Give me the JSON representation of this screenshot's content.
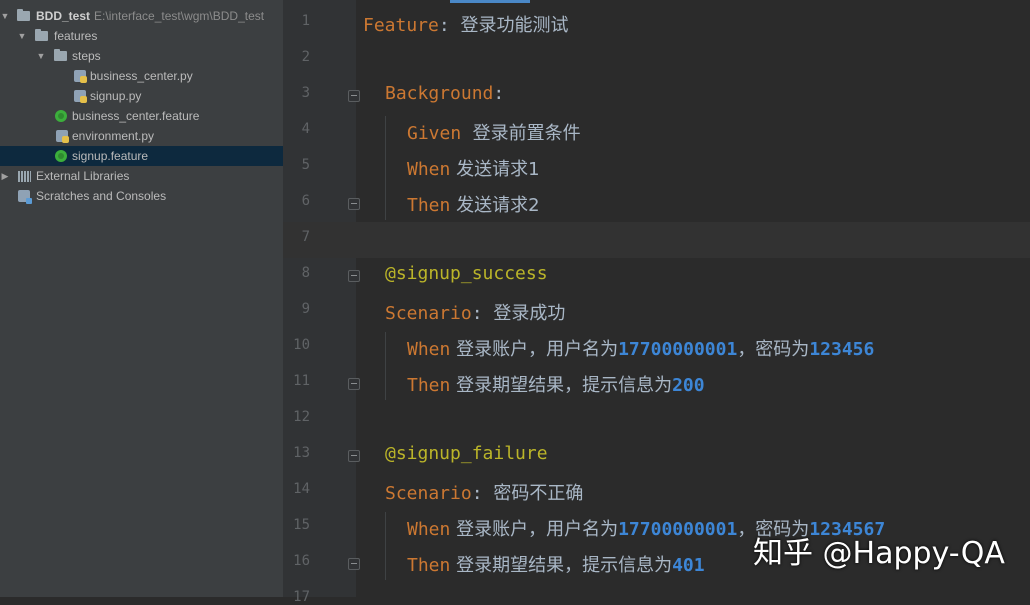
{
  "project_tree": {
    "root": {
      "name": "BDD_test",
      "path": "E:\\interface_test\\wgm\\BDD_test"
    },
    "features": "features",
    "steps": "steps",
    "business_center_py": "business_center.py",
    "signup_py": "signup.py",
    "business_center_feature": "business_center.feature",
    "environment_py": "environment.py",
    "signup_feature": "signup.feature",
    "external_libraries": "External Libraries",
    "scratches": "Scratches and Consoles",
    "selected_item": "signup.feature"
  },
  "editor": {
    "current_line": 7,
    "line_numbers": [
      "1",
      "2",
      "3",
      "4",
      "5",
      "6",
      "7",
      "8",
      "9",
      "10",
      "11",
      "12",
      "13",
      "14",
      "15",
      "16",
      "17"
    ],
    "lines": {
      "l1": {
        "kw": "Feature",
        "sep": ": ",
        "text": "登录功能测试"
      },
      "l3": {
        "kw": "Background",
        "sep": ":"
      },
      "l4": {
        "kw": "Given",
        "text": "  登录前置条件"
      },
      "l5": {
        "kw": "When",
        "text": " 发送请求1"
      },
      "l6": {
        "kw": "Then",
        "text": " 发送请求2"
      },
      "l8": {
        "tag": "@signup_success"
      },
      "l9": {
        "kw": "Scenario",
        "sep": ": ",
        "text": "登录成功"
      },
      "l10": {
        "kw": "When",
        "text1": " 登录账户，用户名为",
        "num1": "17700000001",
        "text2": "，密码为",
        "num2": "123456"
      },
      "l11": {
        "kw": "Then",
        "text1": " 登录期望结果，提示信息为",
        "num1": "200"
      },
      "l13": {
        "tag": "@signup_failure"
      },
      "l14": {
        "kw": "Scenario",
        "sep": ": ",
        "text": "密码不正确"
      },
      "l15": {
        "kw": "When",
        "text1": " 登录账户，用户名为",
        "num1": "17700000001",
        "text2": "，密码为",
        "num2": "1234567"
      },
      "l16": {
        "kw": "Then",
        "text1": " 登录期望结果，提示信息为",
        "num1": "401"
      }
    }
  },
  "watermark": "知乎 @Happy-QA",
  "colors": {
    "keyword": "#cc7832",
    "tag": "#bbb529",
    "number": "#3d86d6",
    "text": "#a9b7c6",
    "selection": "#0d293e"
  }
}
